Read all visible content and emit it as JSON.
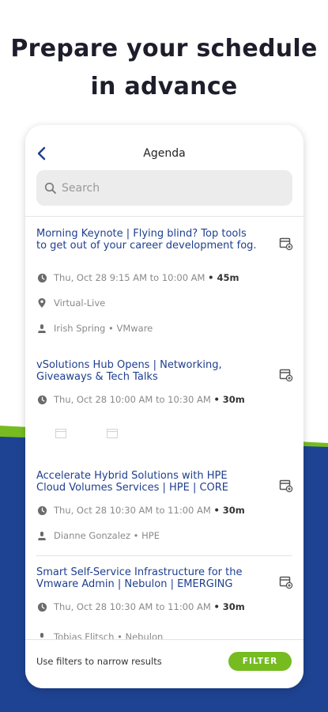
{
  "headline": {
    "line1": "Prepare your schedule",
    "line2": "in advance"
  },
  "header": {
    "title": "Agenda",
    "back_icon": "chevron-left-icon"
  },
  "search": {
    "placeholder": "Search"
  },
  "sessions": [
    {
      "title": "Morning Keynote | Flying blind? Top tools to get out of your career development fog.",
      "time": "Thu, Oct 28 9:15 AM to 10:00 AM",
      "duration": "• 45m",
      "location": "Virtual-Live",
      "speaker": "Irish Spring • VMware"
    },
    {
      "title": "vSolutions Hub Opens | Networking, Giveaways & Tech Talks",
      "time": "Thu, Oct 28 10:00 AM to 10:30 AM",
      "duration": "• 30m"
    },
    {
      "title": "Accelerate Hybrid Solutions with HPE Cloud Volumes Services | HPE | CORE",
      "time": "Thu, Oct 28 10:30 AM to 11:00 AM",
      "duration": "• 30m",
      "speaker": "Dianne Gonzalez • HPE"
    },
    {
      "title": "Smart Self-Service Infrastructure for the Vmware Admin | Nebulon | EMERGING",
      "time": "Thu, Oct 28 10:30 AM to 11:00 AM",
      "duration": "• 30m",
      "speaker": "Tobias Flitsch • Nebulon"
    }
  ],
  "footer": {
    "hint": "Use filters to narrow results",
    "filter_label": "FILTER"
  },
  "colors": {
    "title_blue": "#1e3f8f",
    "accent_green": "#76bc21",
    "band_blue": "#1e4392"
  }
}
